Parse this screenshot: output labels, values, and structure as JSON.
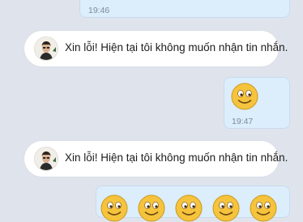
{
  "messages": [
    {
      "kind": "outgoing",
      "time": "19:46"
    },
    {
      "kind": "incoming",
      "text": "Xin lỗi! Hiện tại tôi không muốn nhận tin nhắn."
    },
    {
      "kind": "outgoing",
      "emoji": "smiley-face",
      "time": "19:47"
    },
    {
      "kind": "incoming",
      "text": "Xin lỗi! Hiện tại tôi không muốn nhận tin nhắn."
    },
    {
      "kind": "outgoing",
      "emoji": "smiley-face",
      "emoji_count": 5
    }
  ],
  "colors": {
    "background": "#dfe4ec",
    "outgoing_bubble": "#dcedfc",
    "incoming_bubble": "#ffffff",
    "emoji_yellow": "#f6c33d"
  }
}
